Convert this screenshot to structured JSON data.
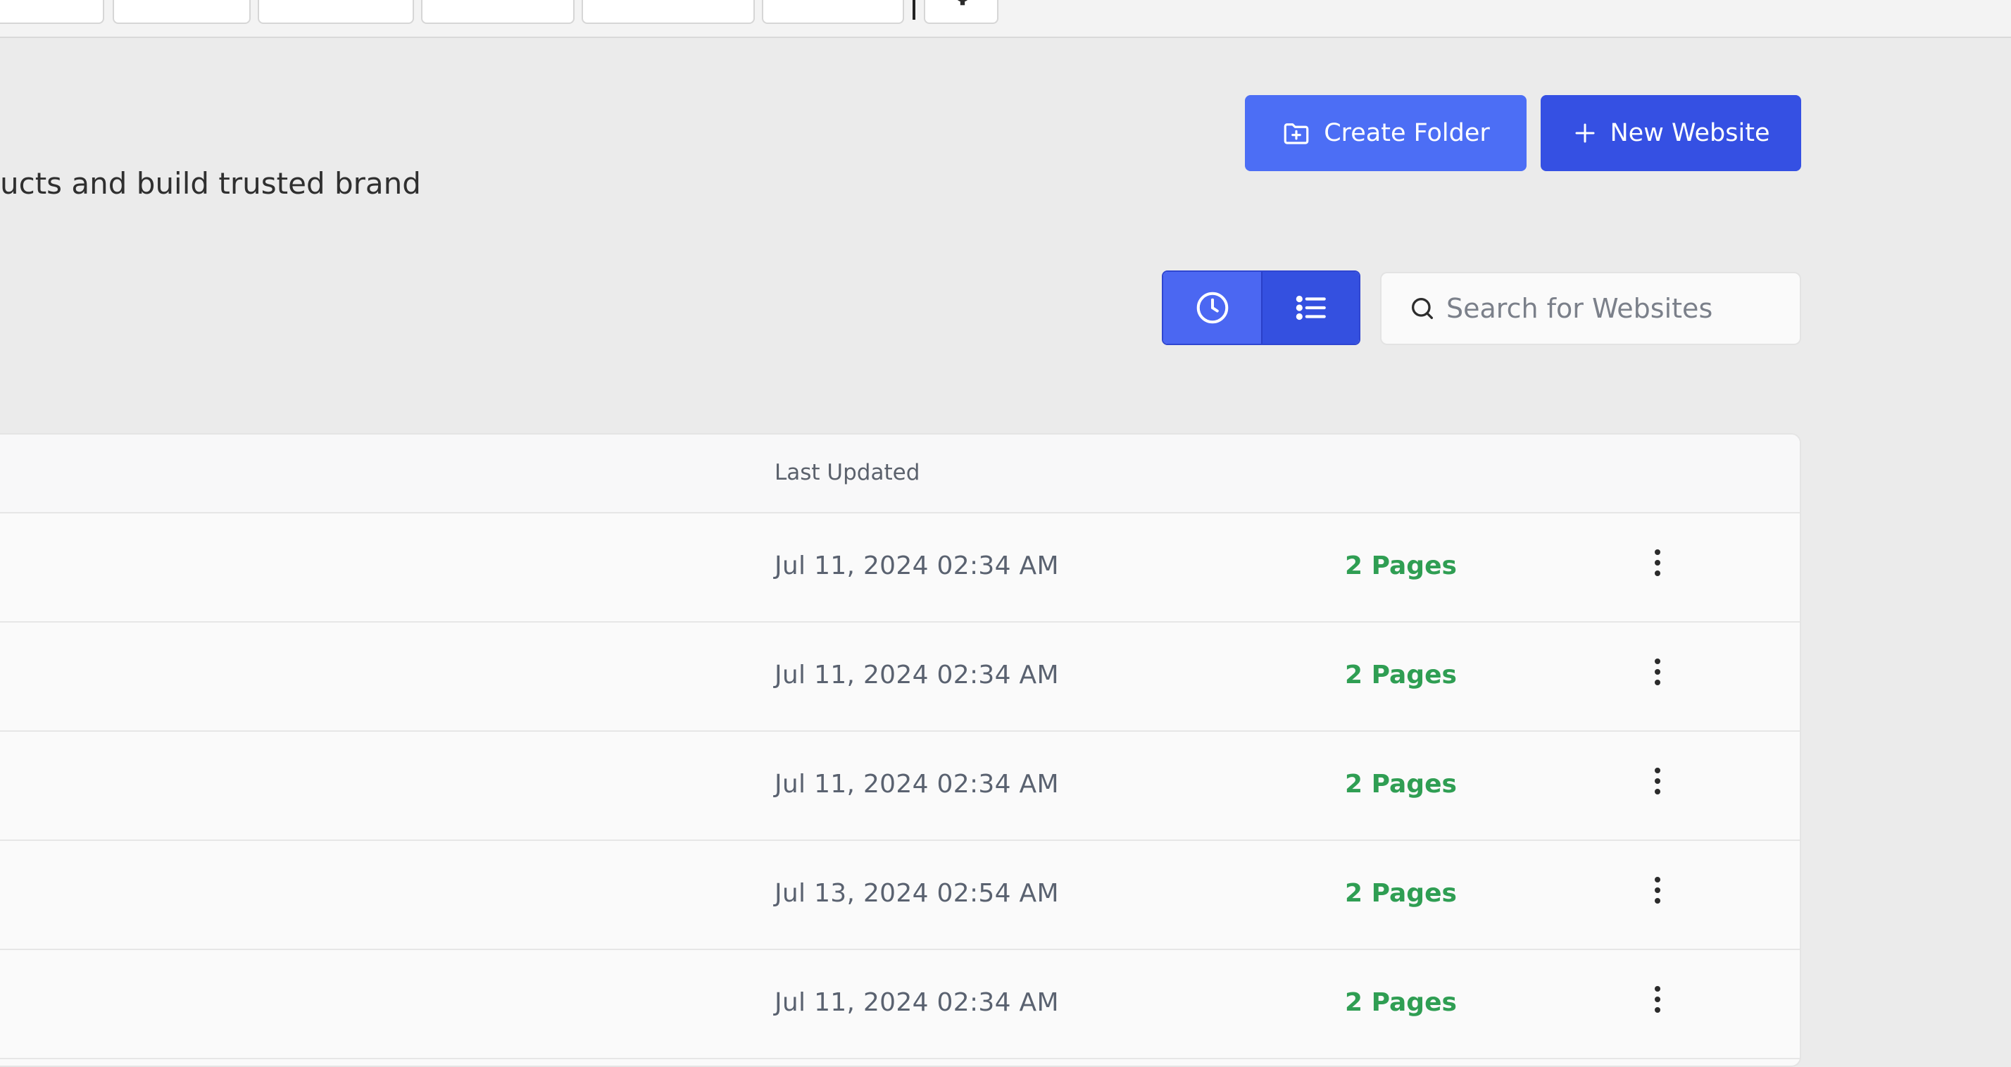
{
  "header": {
    "subtitle": "ucts and build trusted brand"
  },
  "actions": {
    "create_folder_label": "Create Folder",
    "new_website_label": "New Website"
  },
  "search": {
    "placeholder": "Search for Websites"
  },
  "table": {
    "columns": {
      "last_updated": "Last Updated"
    },
    "rows": [
      {
        "last_updated": "Jul 11, 2024 02:34 AM",
        "pages": "2 Pages"
      },
      {
        "last_updated": "Jul 11, 2024 02:34 AM",
        "pages": "2 Pages"
      },
      {
        "last_updated": "Jul 11, 2024 02:34 AM",
        "pages": "2 Pages"
      },
      {
        "last_updated": "Jul 13, 2024 02:54 AM",
        "pages": "2 Pages"
      },
      {
        "last_updated": "Jul 11, 2024 02:34 AM",
        "pages": "2 Pages"
      }
    ]
  },
  "icons": {
    "create_folder": "folder-plus-icon",
    "new_website": "plus-icon",
    "recent_view": "clock-icon",
    "list_view": "list-icon",
    "search": "search-icon",
    "row_menu": "more-vertical-icon",
    "settings": "gear-icon"
  },
  "colors": {
    "primary": "#4c6ef5",
    "primary_dark": "#3550e3",
    "pages_green": "#2f9e53",
    "background": "#ebebeb"
  }
}
